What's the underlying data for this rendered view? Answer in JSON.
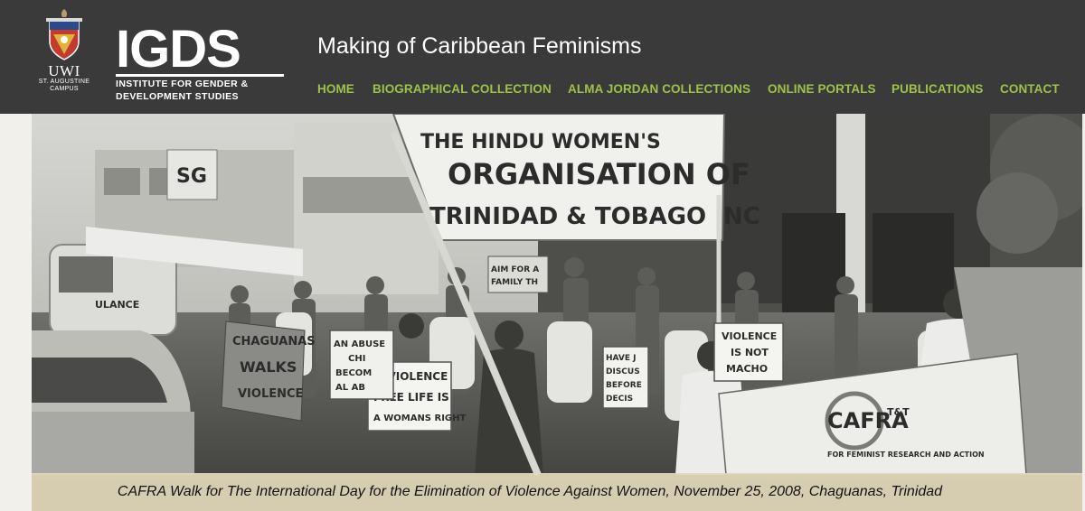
{
  "header": {
    "uwi_logo": {
      "name": "UWI",
      "campus_line1": "ST. AUGUSTINE",
      "campus_line2": "CAMPUS",
      "icon": "crest-icon"
    },
    "igds_logo": {
      "mark": "IGDS",
      "line1": "INSTITUTE FOR GENDER &",
      "line2": "DEVELOPMENT STUDIES"
    },
    "site_title": "Making of Caribbean Feminisms"
  },
  "nav": {
    "items": [
      {
        "label": "HOME"
      },
      {
        "label": "BIOGRAPHICAL COLLECTION"
      },
      {
        "label": "ALMA JORDAN COLLECTIONS"
      },
      {
        "label": "ONLINE PORTALS"
      },
      {
        "label": "PUBLICATIONS"
      },
      {
        "label": "CONTACT"
      }
    ],
    "color": "#9ec24a"
  },
  "hero": {
    "banner_main": [
      "THE HINDU WOMEN'S",
      "ORGANISATION OF",
      "TRINIDAD & TOBAGO INC"
    ],
    "sign_violence_free": [
      "A VIOLENCE",
      "FREE LIFE IS",
      "A WOMANS RIGHT"
    ],
    "sign_not_macho": [
      "VIOLENCE",
      "IS NOT",
      "MACHO"
    ],
    "banner_chaguanas": [
      "CHAGUANAS",
      "WALKS",
      "VIOLENCE"
    ],
    "sign_abuser": [
      "AN ABUSE",
      "CHI",
      "BECOM",
      "AL AB"
    ],
    "sign_discuss": [
      "HAVE J",
      "DISCUS",
      "BEFORE",
      "DECIS"
    ],
    "sign_family": [
      "AIM FOR A",
      "FAMILY TH"
    ],
    "banner_cafra": {
      "logo": "CAFRA",
      "suffix": "T&T",
      "tagline": "FOR FEMINIST RESEARCH AND ACTION"
    },
    "store_sign": "SG",
    "van_text": "ULANCE",
    "caption": "CAFRA Walk for The International Day for the Elimination of Violence Against Women, November 25, 2008, Chaguanas, Trinidad"
  },
  "colors": {
    "header_bg": "#3a3a3a",
    "nav_accent": "#9ec24a",
    "caption_bg": "#e2d8ba"
  }
}
